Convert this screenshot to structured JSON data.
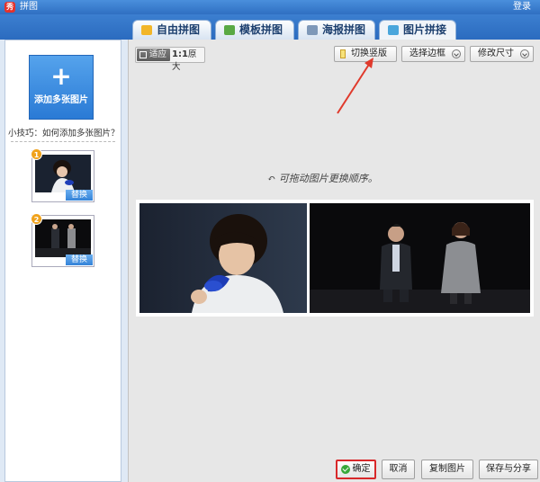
{
  "window": {
    "title": "拼图",
    "app_icon": "秀",
    "login_label": "登录"
  },
  "tabs": [
    {
      "label": "自由拼图",
      "icon": "free-collage-icon",
      "icon_color": "#f2b629"
    },
    {
      "label": "模板拼图",
      "icon": "template-collage-icon",
      "icon_color": "#59a944"
    },
    {
      "label": "海报拼图",
      "icon": "poster-collage-icon",
      "icon_color": "#7e98b8"
    },
    {
      "label": "图片拼接",
      "icon": "image-stitch-icon",
      "icon_color": "#4aa6dc",
      "active": true
    }
  ],
  "sidebar": {
    "add_button": {
      "symbol": "+",
      "label": "添加多张图片"
    },
    "tip": "小技巧：如何添加多张图片？",
    "thumbnails": [
      {
        "number": "1",
        "replace_label": "替换"
      },
      {
        "number": "2",
        "replace_label": "替换"
      }
    ]
  },
  "toolbar": {
    "zoom_fit_label": "适应",
    "zoom_original_prefix": "1:1",
    "zoom_original_label": "原大",
    "switch_vertical_label": "切换竖版",
    "select_border_label": "选择边框",
    "resize_label": "修改尺寸"
  },
  "canvas": {
    "hint": "↶ 可拖动图片更换顺序。"
  },
  "footer": {
    "ok_label": "确定",
    "cancel_label": "取消",
    "copy_label": "复制图片",
    "save_share_label": "保存与分享"
  },
  "colors": {
    "accent_blue": "#2f6fc2",
    "highlight_red": "#d8282a",
    "confirm_green": "#38a83a",
    "badge_orange": "#f0a21c"
  }
}
